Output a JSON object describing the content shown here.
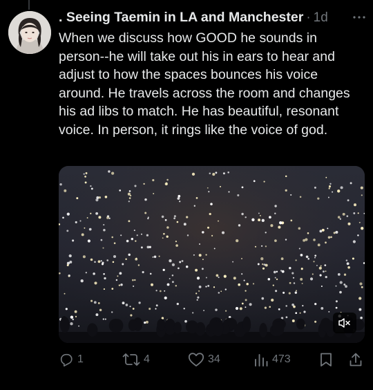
{
  "tweet": {
    "display_name": ". Seeing Taemin in LA and Manchester",
    "separator": "·",
    "timestamp": "1d",
    "text": "When we discuss how GOOD he sounds in person--he will take out his in ears to hear and adjust to how the spaces bounces his voice around. He travels across the room and changes his ad libs to match. He has beautiful, resonant voice. In person, it rings like the voice of god.",
    "media": {
      "type": "video",
      "audio_state": "muted"
    }
  },
  "actions": {
    "replies": "1",
    "reposts": "4",
    "likes": "34",
    "views": "473"
  },
  "icons": {
    "more": "more-dots-icon",
    "reply": "reply-icon",
    "repost": "repost-icon",
    "like": "heart-icon",
    "views": "views-chart-icon",
    "bookmark": "bookmark-icon",
    "share": "share-icon",
    "mute": "speaker-muted-icon"
  },
  "colors": {
    "background": "#000000",
    "text_primary": "#e7e9ea",
    "text_secondary": "#71767b"
  }
}
